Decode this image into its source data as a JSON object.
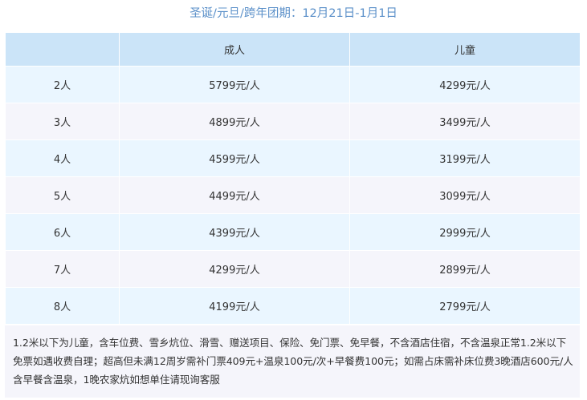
{
  "title": "圣诞/元旦/跨年团期：12月21日-1月1日",
  "table": {
    "headers": [
      "",
      "成人",
      "儿童"
    ],
    "rows": [
      {
        "group": "2人",
        "adult": "5799元/人",
        "child": "4299元/人"
      },
      {
        "group": "3人",
        "adult": "4899元/人",
        "child": "3499元/人"
      },
      {
        "group": "4人",
        "adult": "4599元/人",
        "child": "3199元/人"
      },
      {
        "group": "5人",
        "adult": "4499元/人",
        "child": "3099元/人"
      },
      {
        "group": "6人",
        "adult": "4399元/人",
        "child": "2999元/人"
      },
      {
        "group": "7人",
        "adult": "4299元/人",
        "child": "2899元/人"
      },
      {
        "group": "8人",
        "adult": "4199元/人",
        "child": "2799元/人"
      }
    ]
  },
  "notes": "1.2米以下为儿童，含车位费、雪乡炕位、滑雪、赠送项目、保险、免门票、免早餐，不含酒店住宿，不含温泉正常1.2米以下免票如遇收费自理；超高但未满12周岁需补门票409元+温泉100元/次+早餐费100元；如需占床需补床位费3晚酒店600元/人含早餐含温泉，1晚农家炕如想单住请现询客服",
  "colors": {
    "title": "#5b90c9",
    "header_bg": "#cbe4f8",
    "row_odd_bg": "#eaf6ff",
    "row_even_bg": "#f5f5fb"
  }
}
